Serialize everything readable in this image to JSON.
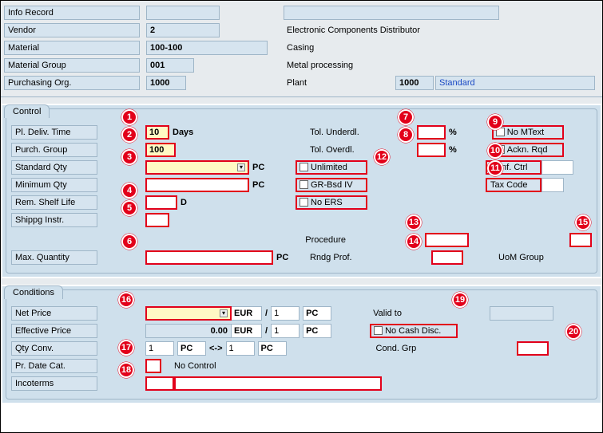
{
  "header": {
    "info_record_lbl": "Info Record",
    "info_record_val": "",
    "vendor_lbl": "Vendor",
    "vendor_val": "2",
    "vendor_desc": "Electronic Components Distributor",
    "material_lbl": "Material",
    "material_val": "100-100",
    "material_desc": "Casing",
    "matgrp_lbl": "Material Group",
    "matgrp_val": "001",
    "matgrp_desc": "Metal processing",
    "porg_lbl": "Purchasing Org.",
    "porg_val": "1000",
    "plant_lbl": "Plant",
    "plant_val": "1000",
    "plant_desc": "Standard"
  },
  "control": {
    "title": "Control",
    "deliv_lbl": "Pl. Deliv. Time",
    "deliv_val": "10",
    "deliv_unit": "Days",
    "pgrp_lbl": "Purch. Group",
    "pgrp_val": "100",
    "stdqty_lbl": "Standard Qty",
    "stdqty_val": "",
    "stdqty_unit": "PC",
    "minqty_lbl": "Minimum Qty",
    "minqty_val": "",
    "minqty_unit": "PC",
    "shelf_lbl": "Rem. Shelf Life",
    "shelf_val": "",
    "shelf_unit": "D",
    "ship_lbl": "Shippg Instr.",
    "ship_val": "",
    "maxqty_lbl": "Max. Quantity",
    "maxqty_val": "",
    "maxqty_unit": "PC",
    "tol_under_lbl": "Tol. Underdl.",
    "tol_under_val": "",
    "tol_over_lbl": "Tol. Overdl.",
    "tol_over_val": "",
    "pct": "%",
    "unlimited_lbl": "Unlimited",
    "grbsd_lbl": "GR-Bsd IV",
    "noers_lbl": "No ERS",
    "nomtext_lbl": "No MText",
    "ackn_lbl": "Ackn. Rqd",
    "conf_lbl": "Conf. Ctrl",
    "conf_val": "",
    "tax_lbl": "Tax Code",
    "tax_val": "",
    "proc_lbl": "Procedure",
    "proc_val": "",
    "rndg_lbl": "Rndg Prof.",
    "rndg_val": "",
    "uom_lbl": "UoM Group",
    "uom_val": ""
  },
  "conditions": {
    "title": "Conditions",
    "netprice_lbl": "Net Price",
    "netprice_val": "",
    "curr": "EUR",
    "slash": "/",
    "per1": "1",
    "unit_pc": "PC",
    "valid_lbl": "Valid to",
    "valid_val": "",
    "effprice_lbl": "Effective Price",
    "effprice_val": "0.00",
    "nocash_lbl": "No Cash Disc.",
    "qtyconv_lbl": "Qty Conv.",
    "qtyconv_v1": "1",
    "qtyconv_u1": "PC",
    "qtyconv_op": "<->",
    "qtyconv_v2": "1",
    "qtyconv_u2": "PC",
    "condgrp_lbl": "Cond. Grp",
    "condgrp_val": "",
    "prdate_lbl": "Pr. Date Cat.",
    "prdate_val": "",
    "prdate_desc": "No Control",
    "inco_lbl": "Incoterms",
    "inco_v1": "",
    "inco_v2": ""
  },
  "markers": [
    "1",
    "2",
    "3",
    "4",
    "5",
    "6",
    "7",
    "8",
    "9",
    "10",
    "11",
    "12",
    "13",
    "14",
    "15",
    "16",
    "17",
    "18",
    "19",
    "20"
  ]
}
